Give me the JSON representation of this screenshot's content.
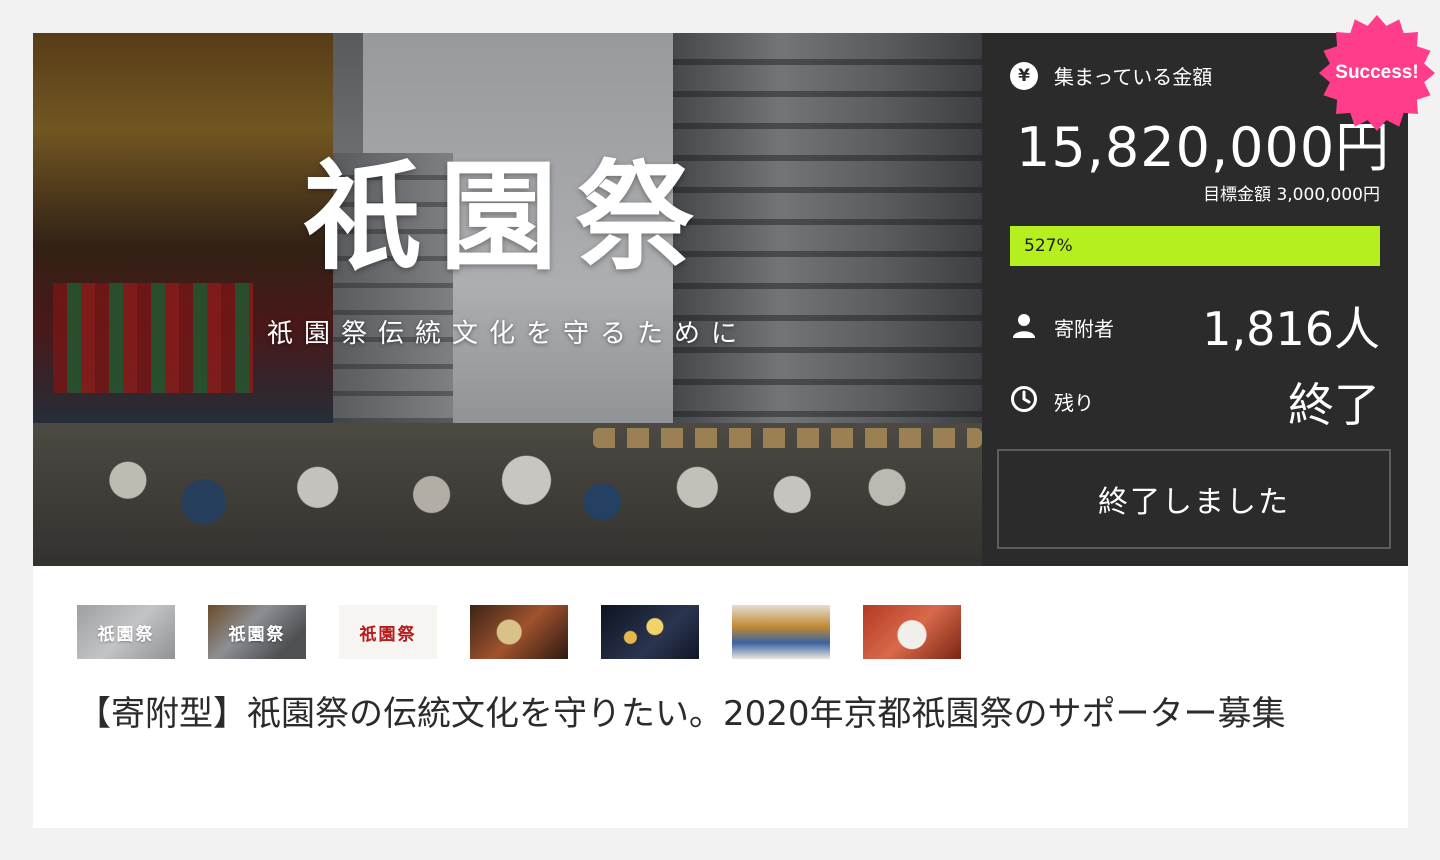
{
  "hero": {
    "title": "祇園祭",
    "subtitle": "祇園祭伝統文化を守るために"
  },
  "stats": {
    "raised_label": "集まっている金額",
    "raised_amount": "15,820,000円",
    "goal_text": "目標金額 3,000,000円",
    "progress_label": "527%",
    "progress_fraction": 1.0,
    "supporters_label": "寄附者",
    "supporters_value": "1,816人",
    "remaining_label": "残り",
    "remaining_value": "終了",
    "end_button": "終了しました",
    "badge": "Success!"
  },
  "colors": {
    "panel_bg": "#2b2b2b",
    "progress": "#b5f01e",
    "badge": "#ff3d8b"
  },
  "icons": {
    "raised": "yen-icon",
    "supporters": "person-icon",
    "remaining": "clock-icon"
  },
  "thumbnails": [
    {
      "text": "祇園祭"
    },
    {
      "text": "祇園祭"
    },
    {
      "text": "祇園祭"
    },
    {
      "text": ""
    },
    {
      "text": ""
    },
    {
      "text": ""
    },
    {
      "text": ""
    }
  ],
  "project": {
    "title": "【寄附型】祇園祭の伝統文化を守りたい。2020年京都祇園祭のサポーター募集"
  }
}
